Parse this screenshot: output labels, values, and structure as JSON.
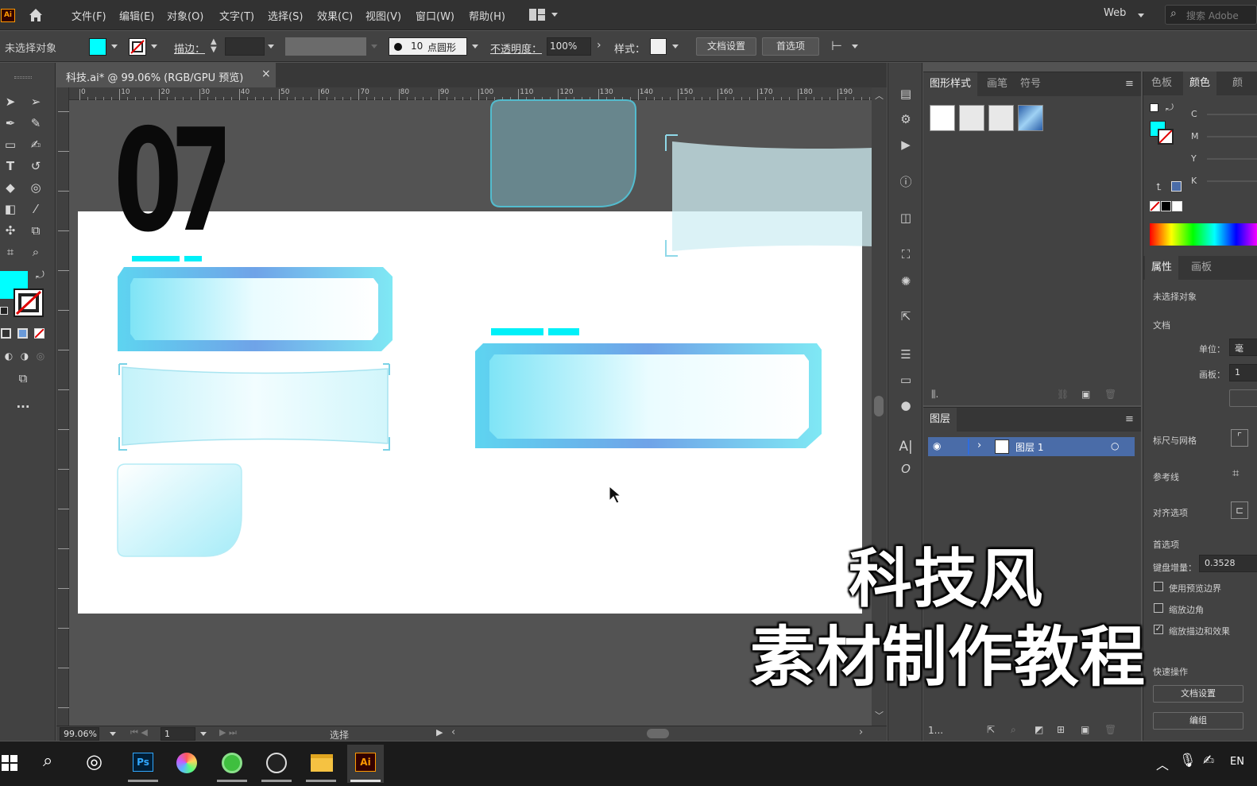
{
  "menubar": {
    "logo": "Ai",
    "items": [
      "文件(F)",
      "编辑(E)",
      "对象(O)",
      "文字(T)",
      "选择(S)",
      "效果(C)",
      "视图(V)",
      "窗口(W)",
      "帮助(H)"
    ],
    "workspace": "Web",
    "search_placeholder": "搜索 Adobe"
  },
  "control": {
    "selection": "未选择对象",
    "stroke_label": "描边：",
    "brush_size": "10",
    "brush_name": "点圆形",
    "opacity_label": "不透明度：",
    "opacity_value": "100%",
    "style_label": "样式：",
    "doc_setup": "文档设置",
    "preferences": "首选项",
    "fill_color": "#00ffff"
  },
  "document": {
    "tab_title": "科技.ai* @ 99.06% (RGB/GPU 预览)",
    "close": "×",
    "number_art": "07",
    "ruler_h": [
      "0",
      "10",
      "20",
      "30",
      "40",
      "50",
      "60",
      "70",
      "80",
      "90",
      "100",
      "110",
      "120",
      "130",
      "140",
      "150",
      "160",
      "170",
      "180",
      "190"
    ]
  },
  "status": {
    "zoom": "99.06%",
    "artboard": "1",
    "tool": "选择"
  },
  "graphic_styles_panel": {
    "tabs": [
      "图形样式",
      "画笔",
      "符号"
    ]
  },
  "layers_panel": {
    "title": "图层",
    "layer_name": "图层 1",
    "footer_count": "1..."
  },
  "color_panel": {
    "tabs": [
      "色板",
      "颜色",
      "颜"
    ],
    "channels": [
      "C",
      "M",
      "Y",
      "K"
    ]
  },
  "properties_panel": {
    "tabs": [
      "属性",
      "画板"
    ],
    "no_selection": "未选择对象",
    "doc_section": "文档",
    "unit_label": "单位：",
    "unit_value": "毫",
    "artboard_label": "画板：",
    "artboard_value": "1",
    "rulers_grid": "标尺与网格",
    "guides": "参考线",
    "align_options": "对齐选项",
    "prefs": "首选项",
    "key_increment_label": "键盘增量：",
    "key_increment_value": "0.3528",
    "use_preview_bounds": "使用预览边界",
    "scale_corners": "缩放边角",
    "scale_strokes": "缩放描边和效果",
    "quick_actions": "快速操作",
    "btn_doc_setup": "文档设置",
    "btn_edit": "编组"
  },
  "caption": {
    "line1": "科技风",
    "line2": "素材制作教程"
  },
  "taskbar": {
    "apps": [
      "Ps",
      "Ai"
    ],
    "lang": "EN"
  }
}
